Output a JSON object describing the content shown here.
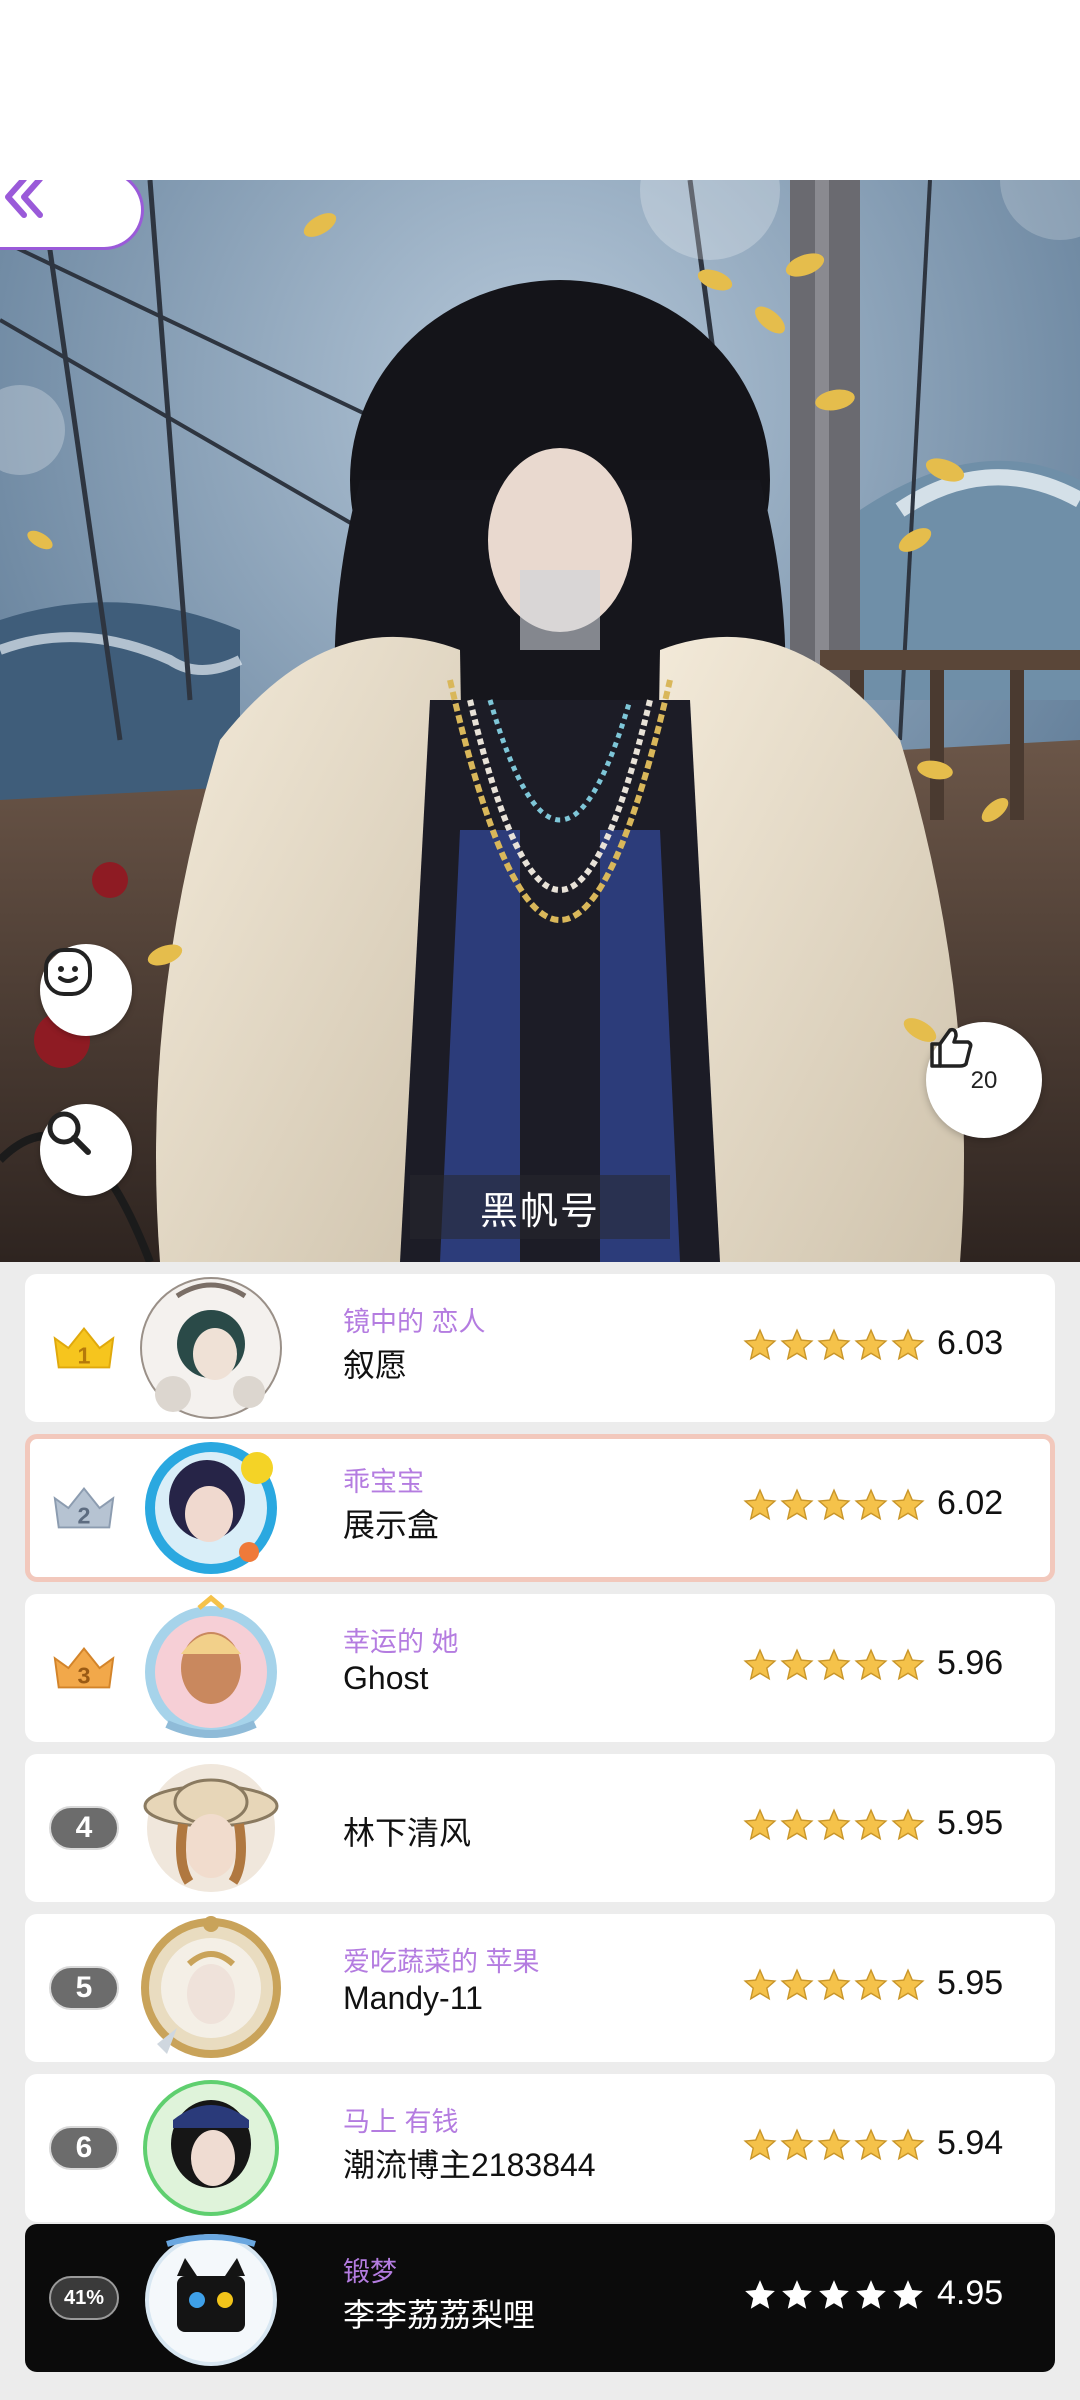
{
  "outfit": {
    "title": "黑帆号",
    "likes": "20"
  },
  "icons": {
    "back": "double-chevron-left-icon",
    "emoji": "smile-icon",
    "search": "search-icon",
    "like": "thumbs-up-icon",
    "star": "star-icon"
  },
  "colors": {
    "accent": "#9a5ad9",
    "subtitle": "#b47ce0",
    "highlight": "#f2c8bc",
    "star": "#f5c24a"
  },
  "ranking": [
    {
      "rank": "1",
      "rank_type": "crown-gold",
      "subtitle": "镜中的 恋人",
      "name": "叙愿",
      "score": "6.03"
    },
    {
      "rank": "2",
      "rank_type": "crown-silver",
      "subtitle": "乖宝宝",
      "name": "展示盒",
      "score": "6.02"
    },
    {
      "rank": "3",
      "rank_type": "crown-bronze",
      "subtitle": "幸运的 她",
      "name": "Ghost",
      "score": "5.96"
    },
    {
      "rank": "4",
      "rank_type": "pill",
      "subtitle": "",
      "name": "林下清风",
      "score": "5.95"
    },
    {
      "rank": "5",
      "rank_type": "pill",
      "subtitle": "爱吃蔬菜的 苹果",
      "name": "Mandy-11",
      "score": "5.95"
    },
    {
      "rank": "6",
      "rank_type": "pill",
      "subtitle": "马上 有钱",
      "name": "潮流博主2183844",
      "score": "5.94"
    }
  ],
  "me": {
    "rank": "41%",
    "subtitle": "锻梦",
    "name": "李李荔荔梨哩",
    "score": "4.95"
  }
}
